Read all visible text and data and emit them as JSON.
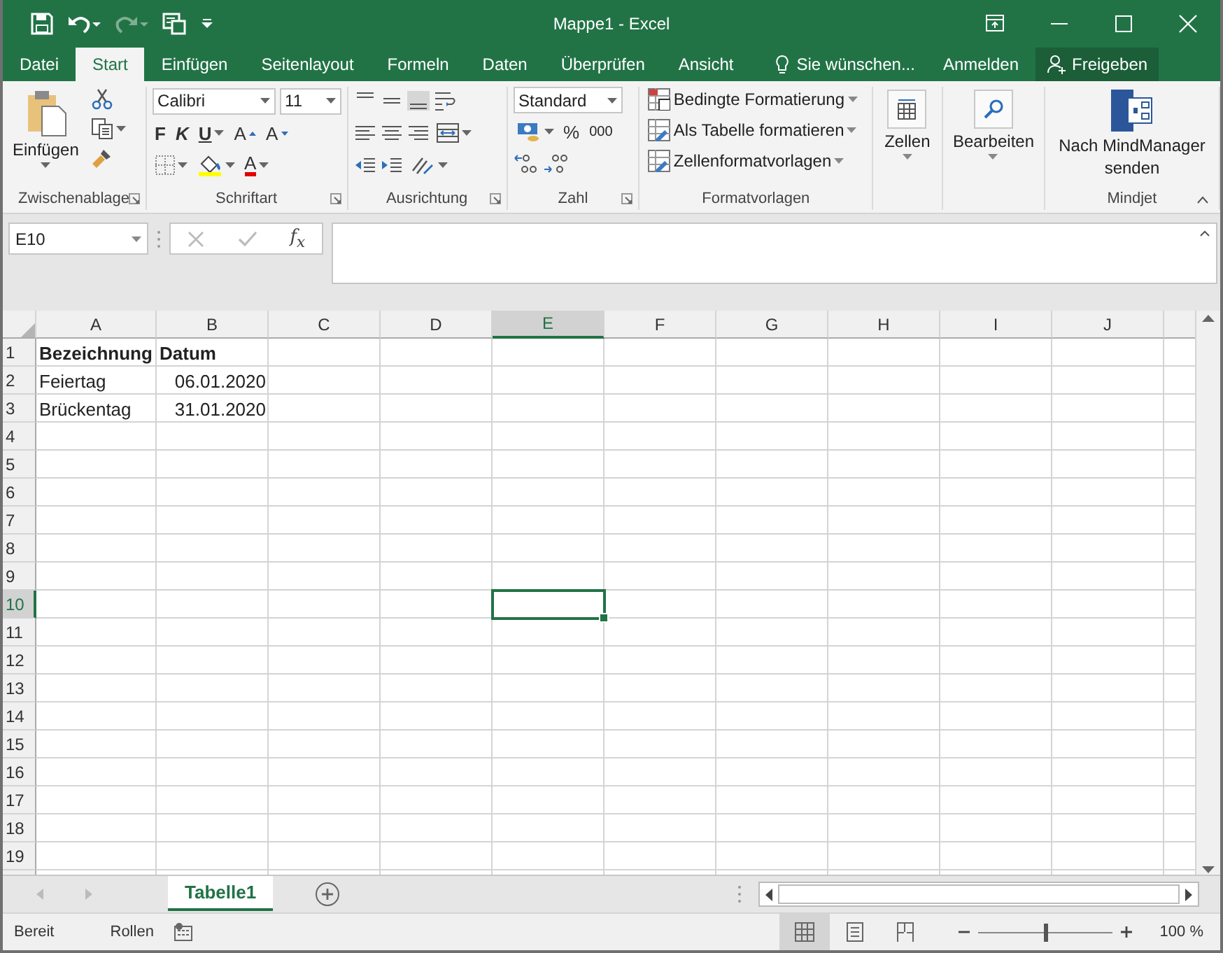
{
  "window": {
    "title": "Mappe1 - Excel"
  },
  "ribbon_tabs": [
    {
      "label": "Datei",
      "selected": false
    },
    {
      "label": "Start",
      "selected": true
    },
    {
      "label": "Einfügen",
      "selected": false
    },
    {
      "label": "Seitenlayout",
      "selected": false
    },
    {
      "label": "Formeln",
      "selected": false
    },
    {
      "label": "Daten",
      "selected": false
    },
    {
      "label": "Überprüfen",
      "selected": false
    },
    {
      "label": "Ansicht",
      "selected": false
    }
  ],
  "tell_me": {
    "label": "Sie wünschen..."
  },
  "account": {
    "sign_in": "Anmelden",
    "share": "Freigeben"
  },
  "ribbon": {
    "clipboard": {
      "label": "Zwischenablage",
      "paste": "Einfügen"
    },
    "font": {
      "label": "Schriftart",
      "font_name": "Calibri",
      "font_size": "11",
      "bold": "F",
      "italic": "K",
      "underline": "U",
      "grow": "A",
      "shrink": "A",
      "font_color": "A"
    },
    "alignment": {
      "label": "Ausrichtung"
    },
    "number": {
      "label": "Zahl",
      "format": "Standard",
      "percent": "%",
      "thousands": "000"
    },
    "styles": {
      "label": "Formatvorlagen",
      "items": [
        "Bedingte Formatierung",
        "Als Tabelle formatieren",
        "Zellenformatvorlagen"
      ]
    },
    "cells": {
      "button": "Zellen"
    },
    "editing": {
      "button": "Bearbeiten"
    },
    "mindjet": {
      "label": "Mindjet",
      "button": "Nach MindManager senden"
    }
  },
  "formula_bar": {
    "name_box": "E10",
    "function": "f$_{x}$"
  },
  "grid": {
    "columns": [
      {
        "label": "A",
        "selected": false
      },
      {
        "label": "B",
        "selected": false
      },
      {
        "label": "C",
        "selected": false
      },
      {
        "label": "D",
        "selected": false
      },
      {
        "label": "E",
        "selected": true
      },
      {
        "label": "F",
        "selected": false
      },
      {
        "label": "G",
        "selected": false
      },
      {
        "label": "H",
        "selected": false
      },
      {
        "label": "I",
        "selected": false
      },
      {
        "label": "J",
        "selected": false
      }
    ],
    "rows": [
      {
        "number": "1",
        "selected": false,
        "cells": [
          {
            "text": "Bezeichnung",
            "kind": "heading"
          },
          {
            "text": "Datum",
            "kind": "heading"
          }
        ]
      },
      {
        "number": "2",
        "selected": false,
        "cells": [
          {
            "text": "Feiertag",
            "kind": "text"
          },
          {
            "text": "06.01.2020",
            "kind": "date"
          }
        ]
      },
      {
        "number": "3",
        "selected": false,
        "cells": [
          {
            "text": "Brückentag",
            "kind": "text"
          },
          {
            "text": "31.01.2020",
            "kind": "date"
          }
        ]
      },
      {
        "number": "4",
        "selected": false,
        "cells": []
      },
      {
        "number": "5",
        "selected": false,
        "cells": []
      },
      {
        "number": "6",
        "selected": false,
        "cells": []
      },
      {
        "number": "7",
        "selected": false,
        "cells": []
      },
      {
        "number": "8",
        "selected": false,
        "cells": []
      },
      {
        "number": "9",
        "selected": false,
        "cells": []
      },
      {
        "number": "10",
        "selected": true,
        "cells": []
      },
      {
        "number": "11",
        "selected": false,
        "cells": []
      },
      {
        "number": "12",
        "selected": false,
        "cells": []
      },
      {
        "number": "13",
        "selected": false,
        "cells": []
      },
      {
        "number": "14",
        "selected": false,
        "cells": []
      },
      {
        "number": "15",
        "selected": false,
        "cells": []
      },
      {
        "number": "16",
        "selected": false,
        "cells": []
      },
      {
        "number": "17",
        "selected": false,
        "cells": []
      },
      {
        "number": "18",
        "selected": false,
        "cells": []
      },
      {
        "number": "19",
        "selected": false,
        "cells": []
      }
    ]
  },
  "sheet_tabs": [
    {
      "label": "Tabelle1",
      "selected": true
    }
  ],
  "status_bar": {
    "mode": "Bereit",
    "scroll_lock": "Rollen",
    "views": [
      {
        "kind": "normal",
        "selected": true
      },
      {
        "kind": "page_layout",
        "selected": false
      },
      {
        "kind": "page_break",
        "selected": false
      }
    ],
    "zoom": {
      "level": 0.5,
      "reading": "100 %"
    }
  }
}
